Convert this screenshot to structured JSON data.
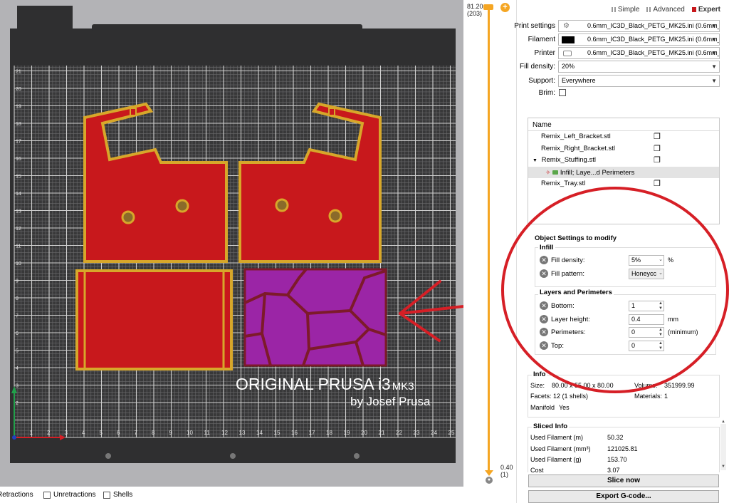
{
  "viewport": {
    "bed_title": "ORIGINAL PRUSA i3",
    "bed_title_suffix": "MK3",
    "bed_subtitle": "by Josef Prusa",
    "x_ticks": [
      "1",
      "2",
      "3",
      "4",
      "5",
      "6",
      "7",
      "8",
      "9",
      "10",
      "11",
      "12",
      "13",
      "14",
      "15",
      "16",
      "17",
      "18",
      "19",
      "20",
      "21",
      "22",
      "23",
      "24",
      "25"
    ],
    "y_ticks": [
      "2",
      "3",
      "4",
      "5",
      "6",
      "7",
      "8",
      "9",
      "10",
      "11",
      "12",
      "13",
      "14",
      "15",
      "16",
      "17",
      "18",
      "19",
      "20",
      "21"
    ],
    "parts_color": "#c8181c",
    "perimeter_color": "#d7a72a",
    "modifier_color": "#9b25a6",
    "annotation_color": "#d61f26"
  },
  "layer_slider": {
    "top_value": "81.20",
    "top_layer": "(203)",
    "bottom_value": "0.40",
    "bottom_layer": "(1)",
    "accent": "#f5a623"
  },
  "legend": {
    "items": [
      "Retractions",
      "Unretractions",
      "Shells"
    ]
  },
  "mode": {
    "simple": "Simple",
    "advanced": "Advanced",
    "expert": "Expert"
  },
  "settings": {
    "print_label": "Print settings",
    "print_value": "0.6mm_IC3D_Black_PETG_MK25.ini (0.6mm_",
    "filament_label": "Filament",
    "filament_value": "0.6mm_IC3D_Black_PETG_MK25.ini (0.6mm_",
    "printer_label": "Printer",
    "printer_value": "0.6mm_IC3D_Black_PETG_MK25.ini (0.6mm_",
    "fill_density_label": "Fill density:",
    "fill_density_value": "20%",
    "support_label": "Support:",
    "support_value": "Everywhere",
    "brim_label": "Brim:"
  },
  "object_list": {
    "header": "Name",
    "items": [
      {
        "name": "Remix_Left_Bracket.stl"
      },
      {
        "name": "Remix_Right_Bracket.stl"
      },
      {
        "name": "Remix_Stuffing.stl"
      },
      {
        "name": "Infill; Laye...d Perimeters"
      },
      {
        "name": "Remix_Tray.stl"
      }
    ]
  },
  "object_settings": {
    "title": "Object Settings to modify",
    "infill_group": "Infill",
    "fill_density_label": "Fill density:",
    "fill_density_value": "5%",
    "fill_density_unit": "%",
    "fill_pattern_label": "Fill pattern:",
    "fill_pattern_value": "Honeycc",
    "layers_group": "Layers and Perimeters",
    "bottom_label": "Bottom:",
    "bottom_value": "1",
    "layer_height_label": "Layer height:",
    "layer_height_value": "0.4",
    "layer_height_unit": "mm",
    "perimeters_label": "Perimeters:",
    "perimeters_value": "0",
    "perimeters_unit": "(minimum)",
    "top_label": "Top:",
    "top_value": "0"
  },
  "info": {
    "title": "Info",
    "size_label": "Size:",
    "size_value": "80.00 x 55.00 x 80.00",
    "volume_label": "Volume:",
    "volume_value": "351999.99",
    "facets_label": "Facets:",
    "facets_value": "12 (1 shells)",
    "materials_label": "Materials:",
    "materials_value": "1",
    "manifold_label": "Manifold",
    "manifold_value": "Yes"
  },
  "sliced_info": {
    "title": "Sliced Info",
    "rows": [
      {
        "label": "Used Filament (m)",
        "value": "50.32"
      },
      {
        "label": "Used Filament (mm³)",
        "value": "121025.81"
      },
      {
        "label": "Used Filament (g)",
        "value": "153.70"
      },
      {
        "label": "Cost",
        "value": "3.07"
      }
    ]
  },
  "actions": {
    "slice": "Slice now",
    "export": "Export G-code..."
  }
}
